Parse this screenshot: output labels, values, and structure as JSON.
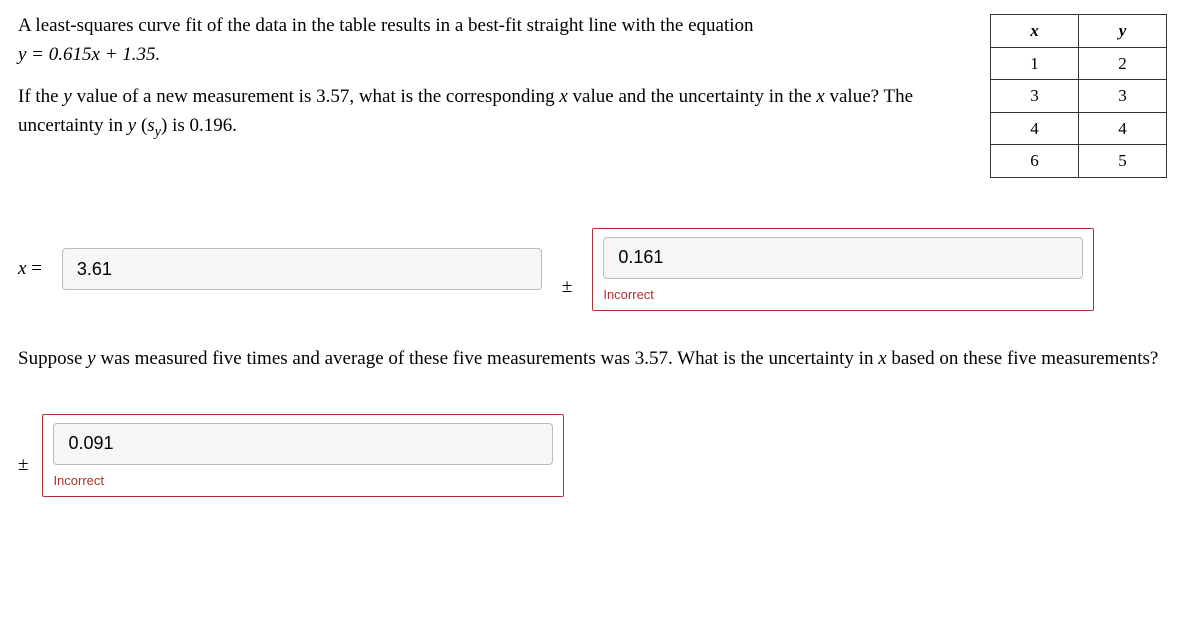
{
  "problem": {
    "line1_a": "A least-squares curve fit of the data in the table results in a best-fit straight line with the equation ",
    "equation": "y = 0.615x + 1.35.",
    "line2_a": "If the ",
    "line2_b": " value of a new measurement is 3.57, what is the corresponding ",
    "line2_c": " value and the uncertainty in the ",
    "line2_d": " value? The uncertainty in ",
    "line2_e": " (",
    "line2_f": ") is 0.196.",
    "y": "y",
    "x": "x",
    "sy_s": "s",
    "sy_y": "y"
  },
  "table": {
    "head_x": "x",
    "head_y": "y",
    "rows": [
      {
        "x": "1",
        "y": "2"
      },
      {
        "x": "3",
        "y": "3"
      },
      {
        "x": "4",
        "y": "4"
      },
      {
        "x": "6",
        "y": "5"
      }
    ]
  },
  "answer1": {
    "label_x": "x",
    "label_eq": " =",
    "value": "3.61",
    "pm": "±",
    "uncertainty": "0.161",
    "incorrect": "Incorrect"
  },
  "problem2": {
    "text_a": "Suppose ",
    "text_b": " was measured five times and average of these five measurements was 3.57. What is the uncertainty in ",
    "text_c": " based on these five measurements?",
    "y": "y",
    "x": "x"
  },
  "answer2": {
    "pm": "±",
    "value": "0.091",
    "incorrect": "Incorrect"
  }
}
